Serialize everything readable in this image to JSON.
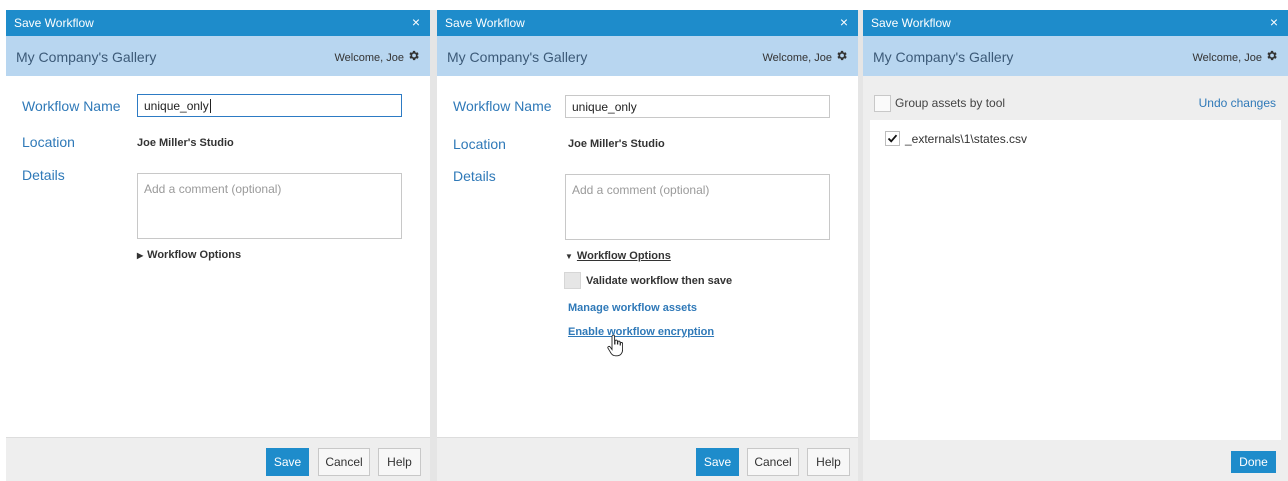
{
  "dialog_title": "Save Workflow",
  "close_glyph": "×",
  "gallery_name": "My Company's Gallery",
  "welcome_text": "Welcome, Joe",
  "form": {
    "workflow_name_label": "Workflow Name",
    "workflow_name_value": "unique_only",
    "location_label": "Location",
    "location_value": "Joe Miller's Studio",
    "details_label": "Details",
    "details_placeholder": "Add a comment (optional)",
    "workflow_options_label": "Workflow Options",
    "collapsed_arrow": "▶",
    "expanded_arrow": "▼",
    "validate_label": "Validate workflow then save",
    "manage_assets_link": "Manage workflow assets",
    "encryption_link": "Enable workflow encryption"
  },
  "buttons": {
    "save": "Save",
    "cancel": "Cancel",
    "help": "Help",
    "done": "Done"
  },
  "assets_panel": {
    "group_by_tool_label": "Group assets by tool",
    "undo_changes": "Undo changes",
    "items": [
      {
        "name": "_externals\\1\\states.csv",
        "checked": true
      }
    ]
  },
  "colors": {
    "accent": "#1e8ccb",
    "gallery_bar": "#b8d6f0",
    "label_blue": "#2f79b8"
  },
  "icons": {
    "settings": "gear-icon",
    "close": "close-icon",
    "cursor": "hand-pointer-icon",
    "check": "checkmark-icon"
  }
}
